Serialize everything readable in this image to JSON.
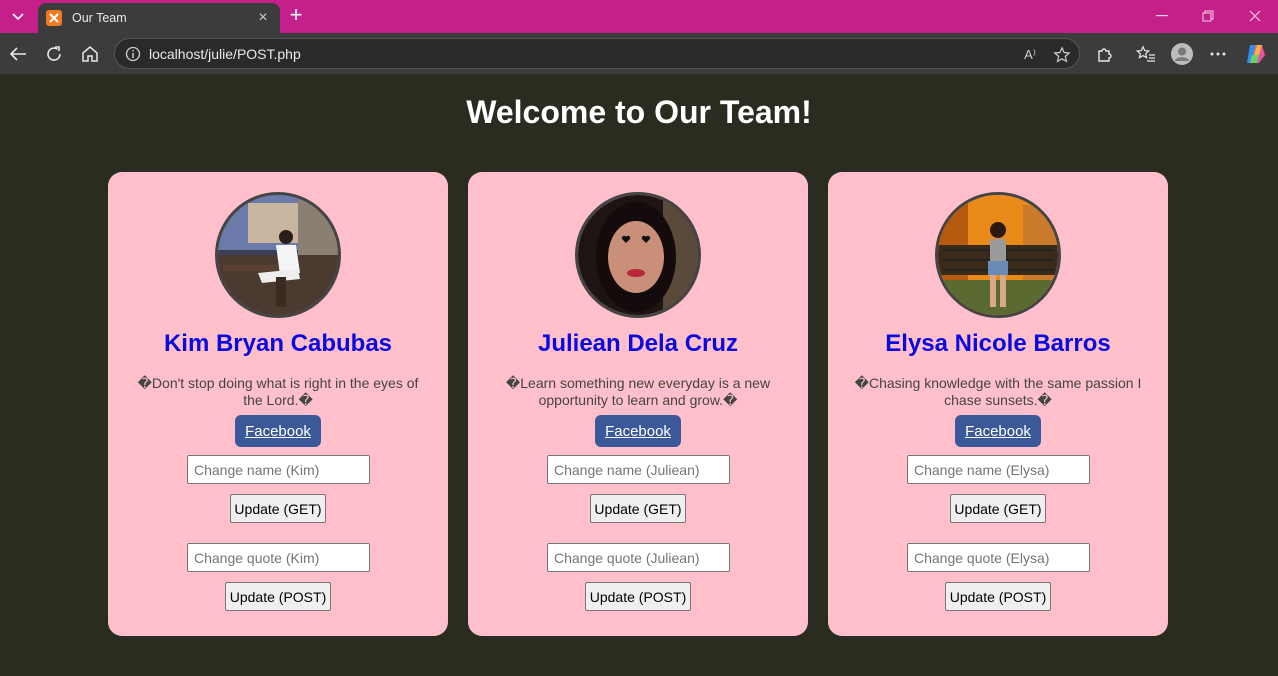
{
  "browser": {
    "tab_title": "Our Team",
    "url": "localhost/julie/POST.php",
    "new_tab_symbol": "+",
    "close_symbol": "×",
    "read_aloud_label": "A⁾"
  },
  "colors": {
    "titlebar": "#c5208a",
    "page_background": "#2b2c20",
    "card_background": "#ffc0cb",
    "name_color": "#0a0add",
    "facebook_button": "#3b5998"
  },
  "page": {
    "title": "Welcome to Our Team!"
  },
  "members": [
    {
      "name": "Kim Bryan Cabubas",
      "quote": "�Don't stop doing what is right in the eyes of the Lord.�",
      "facebook_label": "Facebook",
      "name_placeholder": "Change name (Kim)",
      "get_label": "Update (GET)",
      "quote_placeholder": "Change quote (Kim)",
      "post_label": "Update (POST)"
    },
    {
      "name": "Juliean Dela Cruz",
      "quote": "�Learn something new everyday is a new opportunity to learn and grow.�",
      "facebook_label": "Facebook",
      "name_placeholder": "Change name (Juliean)",
      "get_label": "Update (GET)",
      "quote_placeholder": "Change quote (Juliean)",
      "post_label": "Update (POST)"
    },
    {
      "name": "Elysa Nicole Barros",
      "quote": "�Chasing knowledge with the same passion I chase sunsets.�",
      "facebook_label": "Facebook",
      "name_placeholder": "Change name (Elysa)",
      "get_label": "Update (GET)",
      "quote_placeholder": "Change quote (Elysa)",
      "post_label": "Update (POST)"
    }
  ]
}
